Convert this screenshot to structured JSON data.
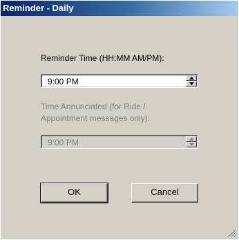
{
  "window": {
    "title": "Reminder - Daily"
  },
  "reminder_time": {
    "label": "Reminder Time (HH:MM  AM/PM):",
    "value": "9:00 PM",
    "enabled": true
  },
  "time_annunciated": {
    "label_line1": "Time Annunciated (for Ride /",
    "label_line2": "Appointment messages only):",
    "value": "9:00 PM",
    "enabled": false
  },
  "buttons": {
    "ok": "OK",
    "cancel": "Cancel"
  },
  "icons": {
    "spin_up": "triangle-up-icon",
    "spin_down": "triangle-down-icon",
    "resize": "resize-grip-icon"
  },
  "colors": {
    "titlebar_start": "#0a246a",
    "titlebar_end": "#a6caf0",
    "face": "#d4d0c8",
    "disabled_text": "#808080"
  }
}
